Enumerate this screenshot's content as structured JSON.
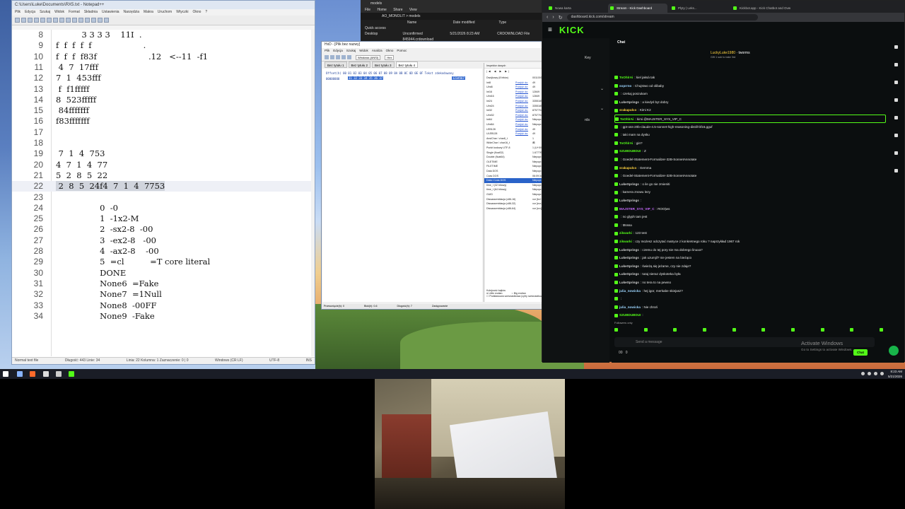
{
  "editor": {
    "title": "C:\\Users\\Luke\\Documents\\RX5.txt - Notepad++",
    "menu": [
      "Plik",
      "Edycja",
      "Szukaj",
      "Widok",
      "Format",
      "Składnia",
      "Ustawienia",
      "Narzędzia",
      "Makra",
      "Uruchom",
      "Wtyczki",
      "Okno",
      "?"
    ],
    "lines": [
      {
        "n": "8",
        "t": "          3 3 3 3    11I  ."
      },
      {
        "n": "9",
        "t": "f  f  f  f  f                    ."
      },
      {
        "n": "10",
        "t": "f  f  f  f83f                    .12   <--11  -f1"
      },
      {
        "n": "11",
        "t": " 4  7  17fff"
      },
      {
        "n": "12",
        "t": "7  1  453fff"
      },
      {
        "n": "13",
        "t": " f  f1fffff"
      },
      {
        "n": "14",
        "t": "8  523fffff"
      },
      {
        "n": "15",
        "t": " 84fffffff"
      },
      {
        "n": "16",
        "t": "f83fffffff"
      },
      {
        "n": "17",
        "t": ""
      },
      {
        "n": "18",
        "t": ""
      },
      {
        "n": "19",
        "t": " 7  1  4  753"
      },
      {
        "n": "20",
        "t": "4  7  1  4  77"
      },
      {
        "n": "21",
        "t": "5  2  8  5  22"
      },
      {
        "n": "22",
        "t": " 2  8  5  24f4  7  1  4  7753"
      },
      {
        "n": "23",
        "t": ""
      },
      {
        "n": "24",
        "t": "                 0  -0"
      },
      {
        "n": "25",
        "t": "                 1  -1x2-M"
      },
      {
        "n": "26",
        "t": "                 2  -sx2-8  -00"
      },
      {
        "n": "27",
        "t": "                 3  -ex2-8   -00"
      },
      {
        "n": "28",
        "t": "                 4  -ax2-8    -00"
      },
      {
        "n": "29",
        "t": "                 5  =cl          =T core literal"
      },
      {
        "n": "30",
        "t": "                 DONE"
      },
      {
        "n": "31",
        "t": "                 None6  =Fake"
      },
      {
        "n": "32",
        "t": "                 None7  =1Null"
      },
      {
        "n": "33",
        "t": "                 None8  -00FF"
      },
      {
        "n": "34",
        "t": "                 None9  -Fake"
      }
    ],
    "status": {
      "left": "Normal text file",
      "mid": "Długość: 443   Linie: 34",
      "pos": "Linia: 22   Kolumna: 1   Zaznaczenie: 0 | 0",
      "eol": "Windows (CR LF)",
      "enc": "UTF-8",
      "ins": "INS"
    }
  },
  "explorer": {
    "title": "models",
    "ribbon": [
      "File",
      "Home",
      "Share",
      "View"
    ],
    "address": "AO_MONOLIT  >  models",
    "columns": [
      "Name",
      "Date modified",
      "Type"
    ],
    "sidebar": [
      "Quick access",
      "Desktop"
    ],
    "row": {
      "name": "Unconfirmed 845944.crdownload",
      "date": "5/21/2026 8:23 AM",
      "type": "CRDOWNLOAD File"
    }
  },
  "hexed": {
    "title": "HxD - [Plik bez nazwy]",
    "menu": [
      "Plik",
      "Edycja",
      "Szukaj",
      "Widok",
      "Analiza",
      "Okno",
      "Pomoc"
    ],
    "toolbar_select": "Windows (ANSI)",
    "toolbar_mode": "Hex",
    "tabs": [
      "Bez tytułu 1",
      "Bez tytułu 2",
      "Bez tytułu 3",
      "Bez tytułu 4"
    ],
    "hex_header": "Offset(h)  00 01 02 03 04 05 06 07 08 09 0A 0B 0C 0D 0E 0F   Tekst zdekodowany",
    "offset": "00000000",
    "bytes": "31 32 33 34 35 36 37",
    "ascii": "1234567",
    "inspector_title": "Inspektor danych",
    "inspector_nav": "|◀ ◀ ▶ ▶|",
    "inspector_rows": [
      {
        "k": "Dwójkowy (8 bitów)",
        "g": "",
        "v": "00110001"
      },
      {
        "k": "Int8",
        "g": "Przejdź do:",
        "v": "49"
      },
      {
        "k": "UInt8",
        "g": "Przejdź do:",
        "v": "49"
      },
      {
        "k": "Int16",
        "g": "Przejdź do:",
        "v": "12849"
      },
      {
        "k": "UInt16",
        "g": "Przejdź do:",
        "v": "12849"
      },
      {
        "k": "Int24",
        "g": "Przejdź do:",
        "v": "3355185"
      },
      {
        "k": "UInt24",
        "g": "Przejdź do:",
        "v": "3355185"
      },
      {
        "k": "Int32",
        "g": "Przejdź do:",
        "v": "875770417"
      },
      {
        "k": "UInt32",
        "g": "Przejdź do:",
        "v": "875770417"
      },
      {
        "k": "Int64",
        "g": "Przejdź do:",
        "v": "Niepoprawny"
      },
      {
        "k": "UInt64",
        "g": "Przejdź do:",
        "v": "Niepoprawny"
      },
      {
        "k": "LEB128",
        "g": "Przejdź do:",
        "v": "49"
      },
      {
        "k": "ULEB128",
        "g": "Przejdź do:",
        "v": "49"
      },
      {
        "k": "AnsiChar / char8_t",
        "g": "",
        "v": "1"
      },
      {
        "k": "WideChar / char16_t",
        "g": "",
        "v": "㈱"
      },
      {
        "k": "Punkt kodowy UTF-8",
        "g": "",
        "v": "1 (U+0031)"
      },
      {
        "k": "Single (float32)",
        "g": "",
        "v": "1.6777E-7"
      },
      {
        "k": "Double (float64)",
        "g": "",
        "v": "Niepoprawny"
      },
      {
        "k": "OLETIME",
        "g": "",
        "v": "Niepoprawny"
      },
      {
        "k": "FILETIME",
        "g": "",
        "v": "Niepoprawny"
      },
      {
        "k": "Data DOS",
        "g": "",
        "v": "Niepoprawny"
      },
      {
        "k": "Czas DOS",
        "g": "",
        "v": "06:09:34"
      },
      {
        "k": "Data i Czas DOS",
        "g": "",
        "v": "Niepoprawny"
      },
      {
        "k": "time_t (32 bitowy)",
        "g": "",
        "v": "Niepoprawny"
      },
      {
        "k": "time_t (64 bitowy)",
        "g": "",
        "v": "Niepoprawny"
      },
      {
        "k": "GUID",
        "g": "",
        "v": "Niepoprawny"
      },
      {
        "k": "Dissassemblacja (x86-16)",
        "g": "",
        "v": "xor [bx+si],si"
      },
      {
        "k": "Dissassemblacja (x86-32)",
        "g": "",
        "v": "xor [ecx],esi"
      },
      {
        "k": "Dissassemblacja (x86-64)",
        "g": "",
        "v": "xor [rcx],esi"
      }
    ],
    "byte_order_label": "Kolejność bajtów",
    "little_endian": "Little endian",
    "big_endian": "Big endian",
    "hex_basic": "Podstawowa szesnastkowa (cyfry szesnastkowe)",
    "status": [
      "Przesunięcie(h): 0",
      "Blok(h): 0-6",
      "Długość(h): 7",
      "Zastępowanie"
    ]
  },
  "browser": {
    "tabs": [
      "Nowa karta",
      "Stream - Kick Dashboard",
      "Plyty | Leks...",
      "Kickbot.app - Kick Chatbot and Overl..."
    ],
    "url": "dashboard.kick.com/stream",
    "logo": "KICK",
    "left_labels": [
      "Key",
      "rds"
    ],
    "chat_title": "Chat",
    "pinned_user": "LuckyLuke1980",
    "pinned_name": "tworms",
    "pinned_sub": "Gift 1 sub to take 3rd",
    "messages": [
      {
        "u": "ToOhlrAi",
        "c": "#53fc18",
        "t": "kiel jaksà tak",
        "hl": false
      },
      {
        "u": "soprrno",
        "c": "#9dd6ff",
        "t": "Chujstwo od olibaby",
        "hl": false
      },
      {
        "u": "",
        "c": "#ff5a5a",
        "t": "czekaj poszukam",
        "hl": false
      },
      {
        "u": "LukeSprings",
        "c": "#cfcfcf",
        "t": "a kiedyś byt dobry",
        "hl": false
      },
      {
        "u": "srakapulco",
        "c": "#ffd23f",
        "t": "Kimi K2",
        "hl": false
      },
      {
        "u": "ToOhlrAi",
        "c": "#53fc18",
        "t": "kimi @MAJSTER_SYS_VIP_C",
        "hl": true
      },
      {
        "u": "",
        "c": "#ff5a5a",
        "t": "gpt-oss-20b-claude-4.5-sonnet-high-reasoning-distill-bf16.gguf",
        "hl": false
      },
      {
        "u": "",
        "c": "#ff5a5a",
        "t": "taki mam na dysku",
        "hl": false
      },
      {
        "u": "ToOhlrAi",
        "c": "#53fc18",
        "t": "gin?",
        "hl": false
      },
      {
        "u": "SZUBDUBDUI",
        "c": "#53fc18",
        "t": "Z",
        "hl": false
      },
      {
        "u": "",
        "c": "#ff5a5a",
        "t": "Goedel-Statement-Formalizer-32B-SonnetAnnotate",
        "hl": false
      },
      {
        "u": "srakapulco",
        "c": "#ffd23f",
        "t": "Gemma",
        "hl": false
      },
      {
        "u": "",
        "c": "#ff5a5a",
        "t": "Goedel-Statement-Formalizer-32B-SonnetAnnotate",
        "hl": false
      },
      {
        "u": "LukeSprings",
        "c": "#cfcfcf",
        "t": "o ile go nie zmieniti",
        "hl": false
      },
      {
        "u": "",
        "c": "#ff5a5a",
        "t": "kamera znowu lezy",
        "hl": false
      },
      {
        "u": "LukeSprings",
        "c": "#cfcfcf",
        "t": "",
        "hl": false
      },
      {
        "u": "MAJSTER_SYS_VIP_C",
        "c": "#c86bff",
        "t": "ROO|ws",
        "hl": false
      },
      {
        "u": "",
        "c": "#ff5a5a",
        "t": "no glyph tam jest",
        "hl": false
      },
      {
        "u": "",
        "c": "#ff5a5a",
        "t": "tttsssa",
        "hl": false
      },
      {
        "u": "zikwarki",
        "c": "#53fc18",
        "t": "123 test",
        "hl": false
      },
      {
        "u": "zikwarki",
        "c": "#53fc18",
        "t": "czy możesz odczytać matryce z konkretnego roku ? naprzykład 1967 rok",
        "hl": false
      },
      {
        "u": "LukeSprings",
        "c": "#cfcfcf",
        "t": "czemu do tej pory nie ma dobrego linuxa?",
        "hl": false
      },
      {
        "u": "LukeSprings",
        "c": "#cfcfcf",
        "t": "jak uzumjil? nie jestem na bieżąco",
        "hl": false
      },
      {
        "u": "LukeSprings",
        "c": "#cfcfcf",
        "t": "świeżą się jeżame, czy nie zdaje?",
        "hl": false
      },
      {
        "u": "LukeSprings",
        "c": "#cfcfcf",
        "t": "tutaj nieraz dyskotekа była",
        "hl": false
      },
      {
        "u": "LukeSprings",
        "c": "#cfcfcf",
        "t": "no tera to na pewno",
        "hl": false
      },
      {
        "u": "julia_nowicka",
        "c": "#9dd6ff",
        "t": "hej igor, merkabe skiejasz?",
        "hl": false
      },
      {
        "u": "",
        "c": "#ff5a5a",
        "t": "",
        "hl": false
      },
      {
        "u": "julia_nowicka",
        "c": "#9dd6ff",
        "t": "Nie chroń",
        "hl": false
      },
      {
        "u": "SZUBDUBDUI",
        "c": "#53fc18",
        "t": "",
        "hl": false
      }
    ],
    "followers_only": "Followers only",
    "send_placeholder": "Send a message",
    "footer_count": "00",
    "footer_zero": "0",
    "chat_button": "Chat",
    "activate_title": "Activate Windows",
    "activate_sub": "Go to Settings to activate Windows."
  },
  "taskbar": {
    "time": "8:23 AM",
    "date": "5/21/2026"
  }
}
